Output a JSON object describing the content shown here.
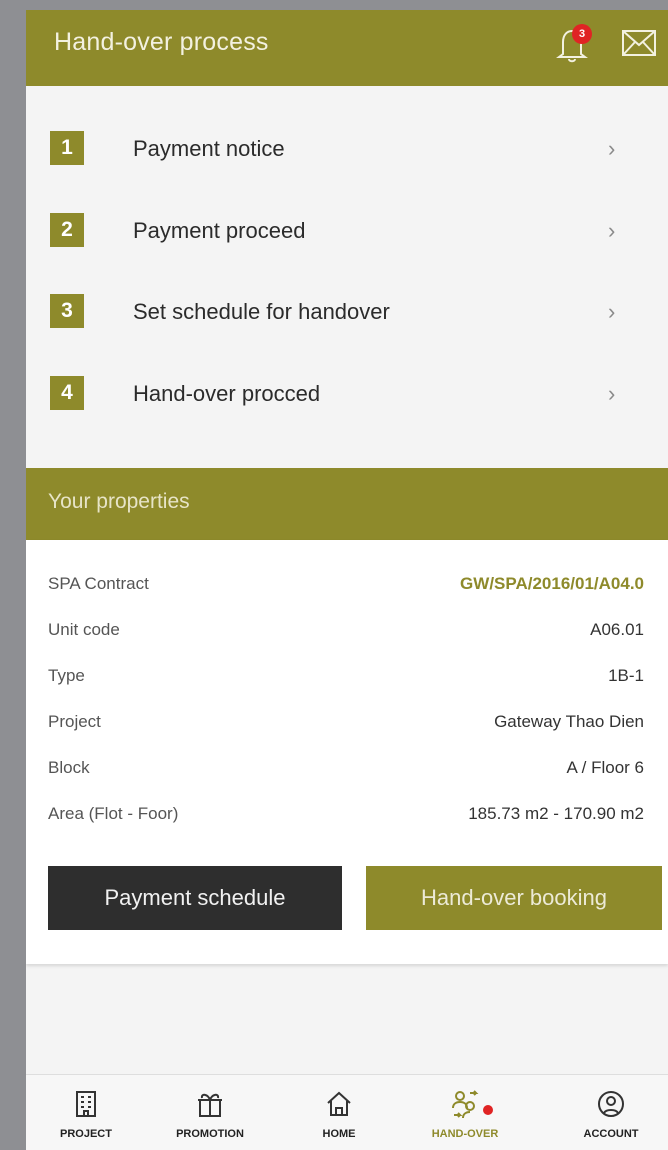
{
  "header": {
    "title": "Hand-over process",
    "notification_count": "3"
  },
  "steps": [
    {
      "number": "1",
      "label": "Payment notice"
    },
    {
      "number": "2",
      "label": "Payment proceed"
    },
    {
      "number": "3",
      "label": "Set schedule for handover"
    },
    {
      "number": "4",
      "label": "Hand-over procced"
    }
  ],
  "properties": {
    "title": "Your properties",
    "rows": [
      {
        "key": "SPA Contract",
        "value": "GW/SPA/2016/01/A04.0"
      },
      {
        "key": "Unit code",
        "value": "A06.01"
      },
      {
        "key": "Type",
        "value": "1B-1"
      },
      {
        "key": "Project",
        "value": "Gateway Thao Dien"
      },
      {
        "key": "Block",
        "value": "A / Floor 6"
      },
      {
        "key": "Area (Flot - Foor)",
        "value": "185.73 m2 - 170.90 m2"
      }
    ],
    "payment_schedule_label": "Payment schedule",
    "handover_booking_label": "Hand-over booking"
  },
  "nav": [
    {
      "label": "PROJECT",
      "icon": "building-icon"
    },
    {
      "label": "PROMOTION",
      "icon": "gift-icon"
    },
    {
      "label": "HOME",
      "icon": "home-icon"
    },
    {
      "label": "HAND-OVER",
      "icon": "handover-icon",
      "active": true
    },
    {
      "label": "ACCOUNT",
      "icon": "account-icon"
    }
  ],
  "colors": {
    "brand": "#8e8a2b",
    "dark_button": "#2e2e2e",
    "badge": "#e02424"
  }
}
